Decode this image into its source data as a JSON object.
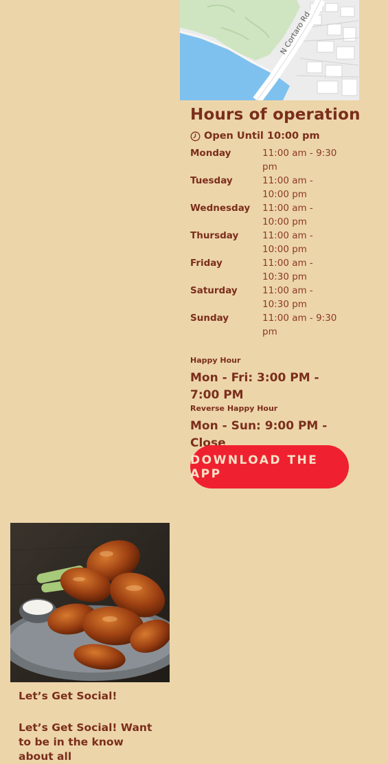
{
  "map": {
    "street_label": "N Cortaro Rd"
  },
  "hours": {
    "title": "Hours of operation",
    "open_status": "Open Until 10:00 pm",
    "days": [
      {
        "day": "Monday",
        "time": "11:00 am - 9:30 pm"
      },
      {
        "day": "Tuesday",
        "time": "11:00 am - 10:00 pm"
      },
      {
        "day": "Wednesday",
        "time": "11:00 am - 10:00 pm"
      },
      {
        "day": "Thursday",
        "time": "11:00 am - 10:00 pm"
      },
      {
        "day": "Friday",
        "time": "11:00 am - 10:30 pm"
      },
      {
        "day": "Saturday",
        "time": "11:00 am - 10:30 pm"
      },
      {
        "day": "Sunday",
        "time": "11:00 am - 9:30 pm"
      }
    ]
  },
  "happy_hour": {
    "label": "Happy Hour",
    "value": "Mon - Fri: 3:00 PM - 7:00 PM"
  },
  "reverse_happy_hour": {
    "label": "Reverse Happy Hour",
    "value": "Mon - Sun: 9:00 PM - Close"
  },
  "app_button": {
    "label": "DOWNLOAD THE APP"
  },
  "social": {
    "heading": "Let’s Get Social!",
    "text": "Let’s Get Social! Want to be in the know about all"
  },
  "colors": {
    "background": "#edd5aa",
    "text": "#7a2e1c",
    "button": "#ef2130",
    "button_text": "#f9e2c6"
  },
  "icons": {
    "clock": "clock-icon"
  }
}
